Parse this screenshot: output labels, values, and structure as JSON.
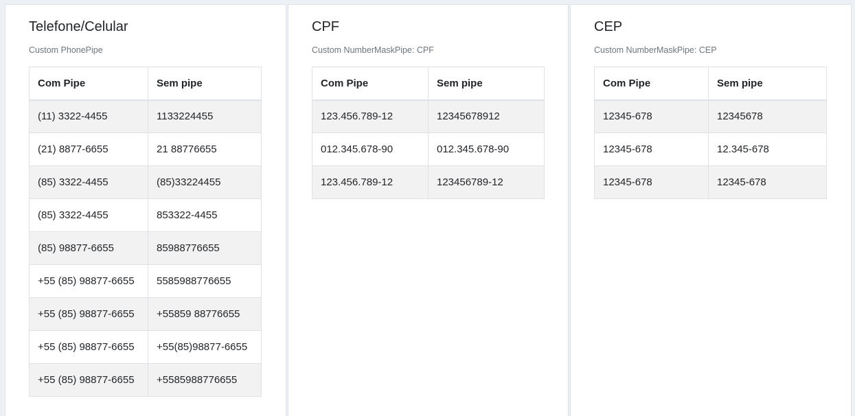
{
  "cards": [
    {
      "title": "Telefone/Celular",
      "subtitle": "Custom PhonePipe",
      "headers": [
        "Com Pipe",
        "Sem pipe"
      ],
      "rows": [
        [
          "(11) 3322-4455",
          "1133224455"
        ],
        [
          "(21) 8877-6655",
          "21 88776655"
        ],
        [
          "(85) 3322-4455",
          "(85)33224455"
        ],
        [
          "(85) 3322-4455",
          "853322-4455"
        ],
        [
          "(85) 98877-6655",
          "85988776655"
        ],
        [
          "+55 (85) 98877-6655",
          "5585988776655"
        ],
        [
          "+55 (85) 98877-6655",
          "+55859 88776655"
        ],
        [
          "+55 (85) 98877-6655",
          "+55(85)98877-6655"
        ],
        [
          "+55 (85) 98877-6655",
          "+5585988776655"
        ]
      ]
    },
    {
      "title": "CPF",
      "subtitle": "Custom NumberMaskPipe: CPF",
      "headers": [
        "Com Pipe",
        "Sem pipe"
      ],
      "rows": [
        [
          "123.456.789-12",
          "12345678912"
        ],
        [
          "012.345.678-90",
          "012.345.678-90"
        ],
        [
          "123.456.789-12",
          "123456789-12"
        ]
      ]
    },
    {
      "title": "CEP",
      "subtitle": "Custom NumberMaskPipe: CEP",
      "headers": [
        "Com Pipe",
        "Sem pipe"
      ],
      "rows": [
        [
          "12345-678",
          "12345678"
        ],
        [
          "12345-678",
          "12.345-678"
        ],
        [
          "12345-678",
          "12345-678"
        ]
      ]
    }
  ]
}
